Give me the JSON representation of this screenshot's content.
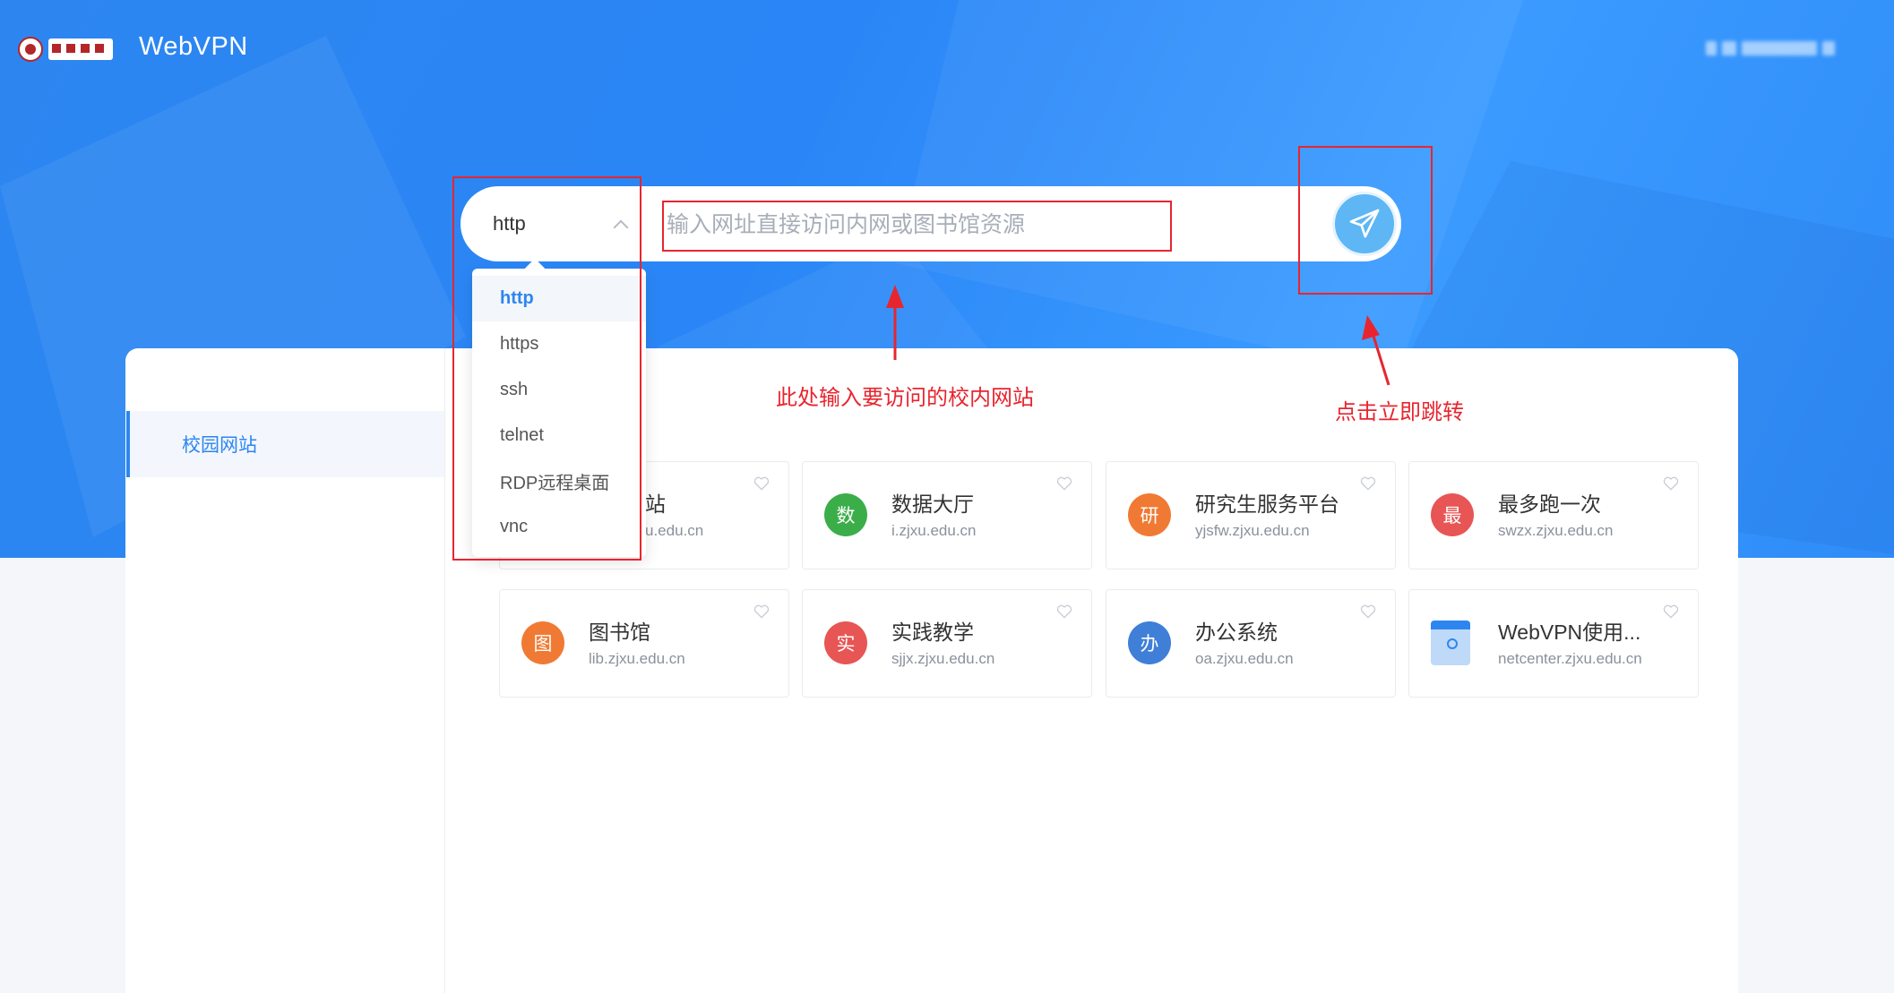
{
  "header": {
    "app_title": "WebVPN",
    "logo_icon": "university-logo-icon"
  },
  "search": {
    "protocol_selected": "http",
    "placeholder": "输入网址直接访问内网或图书馆资源",
    "go_icon": "paper-plane-icon"
  },
  "protocol_options": [
    "http",
    "https",
    "ssh",
    "telnet",
    "RDP远程桌面",
    "vnc"
  ],
  "sidebar": {
    "items": [
      {
        "label": "校园网站"
      }
    ]
  },
  "sites": [
    {
      "name": "站",
      "domain": "u.edu.cn",
      "icon_char": "",
      "color": "#3a9ef0"
    },
    {
      "name": "数据大厅",
      "domain": "i.zjxu.edu.cn",
      "icon_char": "数",
      "color": "#3bae4a"
    },
    {
      "name": "研究生服务平台",
      "domain": "yjsfw.zjxu.edu.cn",
      "icon_char": "研",
      "color": "#f07a34"
    },
    {
      "name": "最多跑一次",
      "domain": "swzx.zjxu.edu.cn",
      "icon_char": "最",
      "color": "#e85555"
    },
    {
      "name": "图书馆",
      "domain": "lib.zjxu.edu.cn",
      "icon_char": "图",
      "color": "#f07a34"
    },
    {
      "name": "实践教学",
      "domain": "sjjx.zjxu.edu.cn",
      "icon_char": "实",
      "color": "#e85555"
    },
    {
      "name": "办公系统",
      "domain": "oa.zjxu.edu.cn",
      "icon_char": "办",
      "color": "#3f7fd8"
    },
    {
      "name": "WebVPN使用...",
      "domain": "netcenter.zjxu.edu.cn",
      "icon_char": "",
      "color": "#bfd9f8"
    }
  ],
  "annotations": {
    "input_hint": "此处输入要访问的校内网站",
    "go_hint": "点击立即跳转"
  },
  "colors": {
    "primary": "#2d86f0",
    "annotation": "#e8252f",
    "go_button": "#5eb6f5"
  }
}
